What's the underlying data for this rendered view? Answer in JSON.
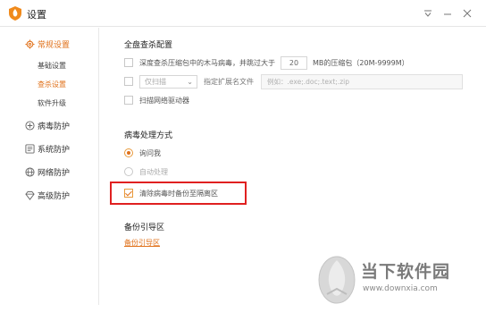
{
  "window": {
    "title": "设置",
    "controls": [
      "menu-icon",
      "minimize-icon",
      "close-icon"
    ]
  },
  "sidebar": {
    "general": {
      "label": "常规设置",
      "icon": "gear-icon"
    },
    "sub_items": [
      {
        "label": "基础设置"
      },
      {
        "label": "查杀设置"
      },
      {
        "label": "软件升级"
      }
    ],
    "items": [
      {
        "label": "病毒防护",
        "icon": "virus-icon"
      },
      {
        "label": "系统防护",
        "icon": "system-icon"
      },
      {
        "label": "网络防护",
        "icon": "globe-icon"
      },
      {
        "label": "高级防护",
        "icon": "diamond-icon"
      }
    ]
  },
  "main": {
    "full_scan": {
      "title": "全盘查杀配置",
      "deep_scan_label_before": "深度查杀压缩包中的木马病毒，并跳过大于",
      "deep_scan_value": "20",
      "deep_scan_label_after": "MB的压缩包（20M-9999M）",
      "scan_mode_select": "仅扫描",
      "ext_label": "指定扩展名文件",
      "ext_placeholder": "例如：.exe;.doc;.text;.zip",
      "network_drive_label": "扫描网络驱动器"
    },
    "virus_handling": {
      "title": "病毒处理方式",
      "ask_label": "询问我",
      "auto_label": "自动处理",
      "backup_label": "清除病毒时备份至隔离区"
    },
    "backup": {
      "title": "备份引导区",
      "link": "备份引导区"
    }
  },
  "watermark": {
    "text": "当下软件园",
    "url": "www.downxia.com"
  },
  "colors": {
    "accent": "#e0711a",
    "highlight_border": "#e02020"
  }
}
